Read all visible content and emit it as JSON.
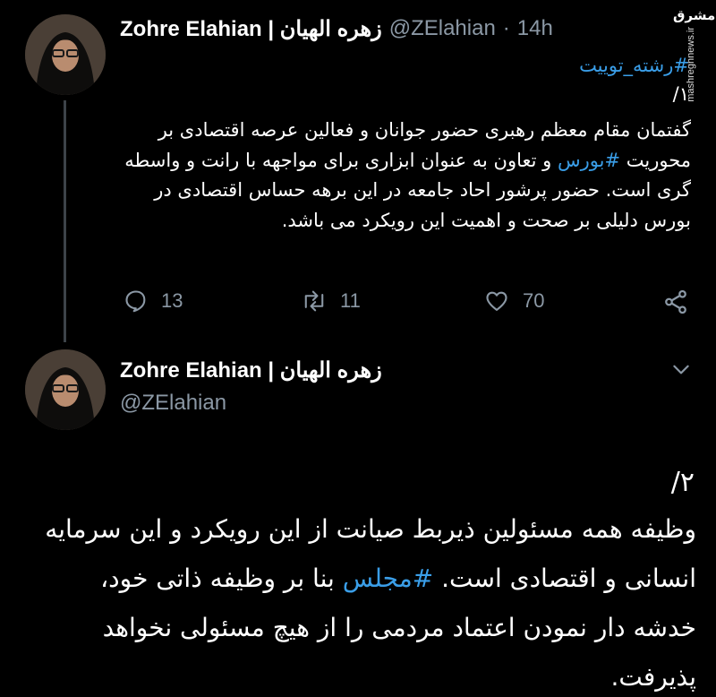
{
  "tweet1": {
    "display_name": "Zohre Elahian | زهره الهیان",
    "handle": "@ZElahian",
    "separator": "·",
    "time": "14h",
    "hashtag_line": "#رشته_توییت",
    "thread_number": "۱/",
    "body_before_tag": "گفتمان مقام معظم رهبری حضور جوانان و فعالین عرصه اقتصادی بر محوریت ",
    "body_tag": "#بورس",
    "body_after_tag": " و تعاون به عنوان ابزاری برای مواجهه با رانت و واسطه گری است. حضور پرشور احاد جامعه در این برهه حساس اقتصادی در بورس دلیلی بر صحت و اهمیت  این رویکرد می باشد.",
    "reply_count": "13",
    "retweet_count": "11",
    "like_count": "70"
  },
  "tweet2": {
    "display_name": "Zohre Elahian | زهره الهیان",
    "handle": "@ZElahian",
    "thread_number": "۲/",
    "body_before_tag": "وظیفه همه مسئولین ذیربط صیانت از این  رویکرد و این سرمایه انسانی و اقتصادی است. ",
    "body_tag": "#مجلس",
    "body_after_tag": " بنا بر وظیفه ذاتی خود، خدشه دار نمودن اعتماد مردمی را از هیچ مسئولی نخواهد پذیرفت."
  },
  "watermark": {
    "logo_text": "مشرق",
    "site": "mashreghnews.ir"
  },
  "colors": {
    "background": "#000000",
    "hashtag": "#3a9ee8",
    "muted": "#8b98a5"
  },
  "icons": [
    "reply-icon",
    "retweet-icon",
    "like-icon",
    "share-icon",
    "chevron-down-icon"
  ]
}
